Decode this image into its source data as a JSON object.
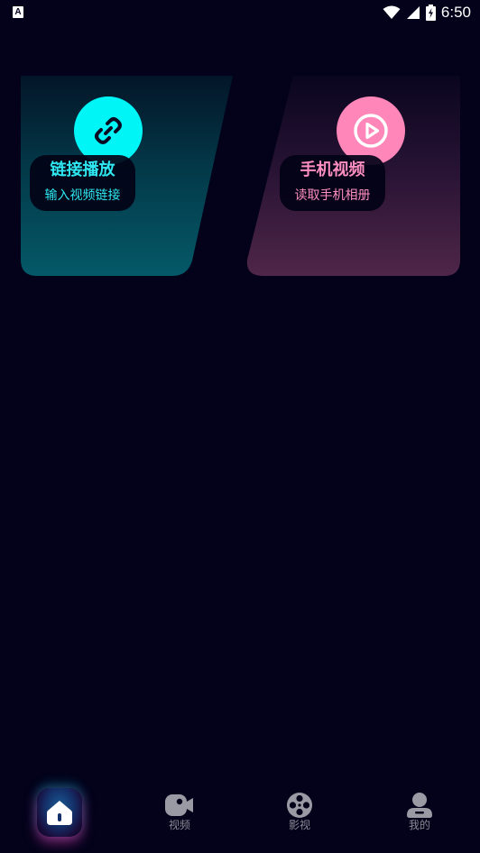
{
  "status_bar": {
    "notification_letter": "A",
    "time": "6:50"
  },
  "cards": {
    "link": {
      "title": "链接播放",
      "subtitle": "输入视频链接",
      "icon": "link-icon",
      "accent": "#00f6f6"
    },
    "phone": {
      "title": "手机视频",
      "subtitle": "读取手机相册",
      "icon": "play-circle-icon",
      "accent": "#ff86b8"
    }
  },
  "bottom_nav": {
    "items": [
      {
        "label": "",
        "icon": "home-icon",
        "active": true
      },
      {
        "label": "视频",
        "icon": "video-camera-icon",
        "active": false
      },
      {
        "label": "影视",
        "icon": "film-reel-icon",
        "active": false
      },
      {
        "label": "我的",
        "icon": "user-icon",
        "active": false
      }
    ]
  },
  "colors": {
    "background": "#03021a",
    "nav_inactive": "#8b8b96"
  }
}
